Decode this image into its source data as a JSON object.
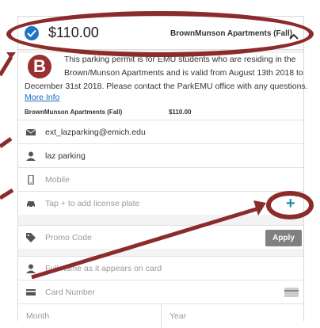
{
  "permit": {
    "price": "$110.00",
    "name": "BrownMunson Apartments (Fall)",
    "logo_letter": "B",
    "desc_line1": "This parking permit is for EMU students who are residing in the",
    "desc_line2": "Brown/Munson Apartments and is valid from August 13th 2018 to",
    "desc_line3": "December 31st 2018. Please contact the ParkEMU office with any questions.",
    "more_info": "More Info",
    "summary_name": "BrownMunson Apartments (Fall)",
    "summary_price": "$110.00"
  },
  "fields": {
    "email": "ext_lazparking@emich.edu",
    "name": "laz parking",
    "mobile_placeholder": "Mobile",
    "plate_placeholder": "Tap + to add license plate",
    "promo_placeholder": "Promo Code",
    "apply_label": "Apply",
    "card_name_placeholder": "Full name as it appears on card",
    "card_number_placeholder": "Card Number",
    "month_placeholder": "Month",
    "year_placeholder": "Year"
  },
  "colors": {
    "accent_blue": "#1e74c6",
    "annotation": "#8b2b2b",
    "plus": "#1b8fb3"
  }
}
